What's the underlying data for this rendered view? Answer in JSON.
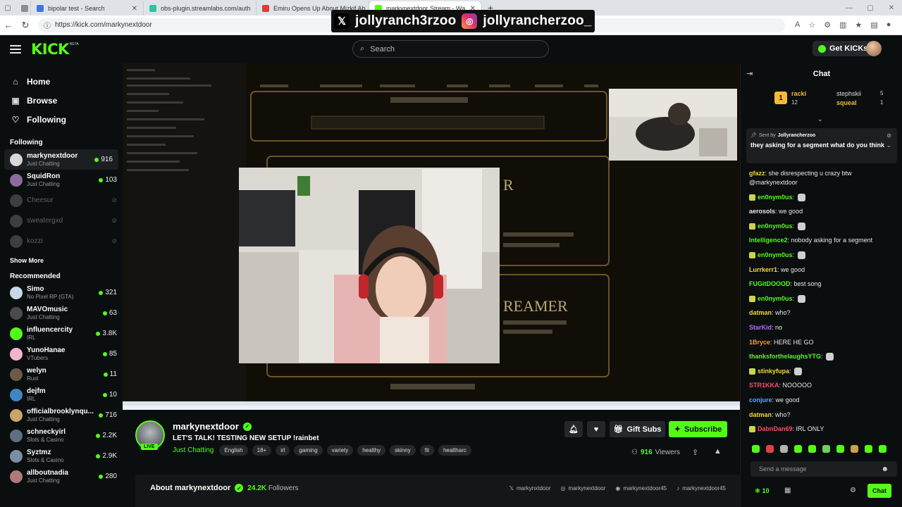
{
  "browser": {
    "tabs": [
      {
        "title": "",
        "fav": "#8e8e8e"
      },
      {
        "title": "bipolar test - Search",
        "fav": "#3b78e7"
      },
      {
        "title": "obs-plugin.streamlabs.com/auth",
        "fav": "#31c4a2"
      },
      {
        "title": "Emiru Opens Up About Mizkif Ab",
        "fav": "#e53935"
      },
      {
        "title": "markynextdoor Stream - Wa",
        "fav": "#53fc18"
      }
    ],
    "url": "https://kick.com/markynextdoor"
  },
  "overlay": {
    "x_handle": "jollyranch3rzoo",
    "ig_handle": "jollyrancherzoo_"
  },
  "header": {
    "logo": "KICK",
    "beta": "BETA",
    "search_placeholder": "Search",
    "get_kicks": "Get KICKs"
  },
  "sidebar": {
    "nav": [
      {
        "label": "Home",
        "icon": "home-icon",
        "glyph": "⌂"
      },
      {
        "label": "Browse",
        "icon": "browse-icon",
        "glyph": "▣"
      },
      {
        "label": "Following",
        "icon": "heart-icon",
        "glyph": "♡"
      }
    ],
    "following_title": "Following",
    "following": [
      {
        "name": "markynextdoor",
        "category": "Just Chatting",
        "viewers": "916",
        "online": true,
        "color": "#d8d8d8"
      },
      {
        "name": "SquidRon",
        "category": "Just Chatting",
        "viewers": "103",
        "online": true,
        "color": "#8c6b9e"
      },
      {
        "name": "Cheesur",
        "category": "",
        "viewers": "",
        "online": false,
        "color": "#888"
      },
      {
        "name": "sweatergxd",
        "category": "",
        "viewers": "",
        "online": false,
        "color": "#888"
      },
      {
        "name": "kozzi",
        "category": "",
        "viewers": "",
        "online": false,
        "color": "#888"
      }
    ],
    "show_more": "Show More",
    "recommended_title": "Recommended",
    "recommended": [
      {
        "name": "Simo",
        "category": "No Pixel RP (GTA)",
        "viewers": "321",
        "color": "#c9d8e6"
      },
      {
        "name": "MAVOmusic",
        "category": "Just Chatting",
        "viewers": "63",
        "color": "#4a4a4a"
      },
      {
        "name": "influencercity",
        "category": "IRL",
        "viewers": "3.8K",
        "color": "#53fc18"
      },
      {
        "name": "YunoHanae",
        "category": "VTubers",
        "viewers": "85",
        "color": "#f0b4d0"
      },
      {
        "name": "welyn",
        "category": "Rust",
        "viewers": "11",
        "color": "#6b5a4a"
      },
      {
        "name": "dejfm",
        "category": "IRL",
        "viewers": "10",
        "color": "#3f87c4"
      },
      {
        "name": "officialbrooklynqu...",
        "category": "Just Chatting",
        "viewers": "716",
        "color": "#c9a46b"
      },
      {
        "name": "schneckyirl",
        "category": "Slots & Casino",
        "viewers": "2.2K",
        "color": "#5f6f7f"
      },
      {
        "name": "Syztmz",
        "category": "Slots & Casino",
        "viewers": "2.9K",
        "color": "#7a8fa3"
      },
      {
        "name": "allboutnadia",
        "category": "Just Chatting",
        "viewers": "280",
        "color": "#b07a7a"
      }
    ]
  },
  "stream": {
    "name": "markynextdoor",
    "title": "LET'S TALK! TESTING NEW SETUP !rainbet",
    "category": "Just Chatting",
    "tags": [
      "English",
      "18+",
      "irl",
      "gaming",
      "variety",
      "healthy",
      "skinny",
      "fit",
      "healtharc"
    ],
    "live": "LIVE",
    "gift_subs": "Gift Subs",
    "subscribe": "Subscribe",
    "viewers": "916",
    "viewers_label": "Viewers",
    "about": "About markynextdoor",
    "followers": "24.2K",
    "followers_label": "Followers",
    "socials": [
      {
        "icon": "x-icon",
        "glyph": "𝕏",
        "handle": "markynxtdoor"
      },
      {
        "icon": "instagram-icon",
        "glyph": "◎",
        "handle": "markynextdoor"
      },
      {
        "icon": "discord-icon",
        "glyph": "◉",
        "handle": "markynextdoor45"
      },
      {
        "icon": "tiktok-icon",
        "glyph": "♪",
        "handle": "markynextdoor45"
      }
    ]
  },
  "chat": {
    "title": "Chat",
    "leaderboard": {
      "first": {
        "name": "racki",
        "count": "12"
      },
      "second": {
        "name": "stephskii",
        "count": "5"
      },
      "third": {
        "name": "squeal",
        "count": "1"
      }
    },
    "pinned": {
      "sent_by_label": "Sent by",
      "sender": "Jollyrancherzoo",
      "message": "they asking for a segment what do you think"
    },
    "messages": [
      {
        "user": "gfazz",
        "color": "#f6d743",
        "text": "she disrespecting u crazy btw @markynextdoor",
        "badge": false,
        "emote": false
      },
      {
        "user": "en0nym0us",
        "color": "#53fc18",
        "text": "",
        "badge": true,
        "emote": true
      },
      {
        "user": "aerosols",
        "color": "#e8e8e8",
        "text": "we good",
        "badge": false,
        "emote": false
      },
      {
        "user": "en0nym0us",
        "color": "#53fc18",
        "text": "",
        "badge": true,
        "emote": true
      },
      {
        "user": "Intelligence2",
        "color": "#53fc18",
        "text": "nobody asking for a segment",
        "badge": false,
        "emote": false
      },
      {
        "user": "en0nym0us",
        "color": "#53fc18",
        "text": "",
        "badge": true,
        "emote": true
      },
      {
        "user": "Lurrkerr1",
        "color": "#f6d743",
        "text": "we good",
        "badge": false,
        "emote": false
      },
      {
        "user": "FUGitDOOOD",
        "color": "#53fc18",
        "text": "best song",
        "badge": false,
        "emote": false
      },
      {
        "user": "en0nym0us",
        "color": "#53fc18",
        "text": "",
        "badge": true,
        "emote": true
      },
      {
        "user": "datman",
        "color": "#f6d743",
        "text": "who?",
        "badge": false,
        "emote": false
      },
      {
        "user": "StarKid",
        "color": "#b36bff",
        "text": "no",
        "badge": false,
        "emote": false
      },
      {
        "user": "1Bryce",
        "color": "#ff9a3c",
        "text": "HERE HE GO",
        "badge": false,
        "emote": false
      },
      {
        "user": "thanksforthelaughsYTG",
        "color": "#53fc18",
        "text": "",
        "badge": false,
        "emote": true
      },
      {
        "user": "stinkyfupa",
        "color": "#f6d743",
        "text": "",
        "badge": true,
        "emote": true
      },
      {
        "user": "STR1KKA",
        "color": "#ff4a6b",
        "text": "NOOOOO",
        "badge": false,
        "emote": false
      },
      {
        "user": "conjure",
        "color": "#5aa9ff",
        "text": "we good",
        "badge": false,
        "emote": false
      },
      {
        "user": "datman",
        "color": "#f6d743",
        "text": "who?",
        "badge": false,
        "emote": false
      },
      {
        "user": "DabnDan69",
        "color": "#ff4a6b",
        "text": "IRL ONLY",
        "badge": true,
        "emote": false
      }
    ],
    "input_placeholder": "Send a message",
    "points": "10",
    "send": "Chat"
  },
  "colors": {
    "brand": "#53fc18",
    "bg": "#0b0e0f",
    "panel": "#1b1f22"
  }
}
